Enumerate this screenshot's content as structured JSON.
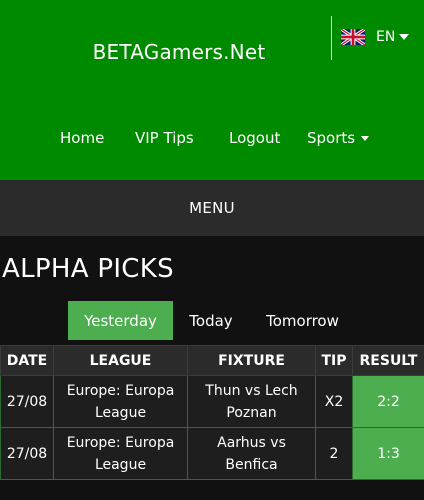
{
  "header": {
    "site_title": "BETAGamers.Net",
    "language": {
      "label": "EN",
      "flag_icon": "uk-flag-icon"
    }
  },
  "nav": {
    "items": [
      {
        "label": "Home"
      },
      {
        "label": "VIP Tips"
      },
      {
        "label": "Logout"
      },
      {
        "label": "Sports"
      }
    ]
  },
  "menu": {
    "label": "MENU"
  },
  "section": {
    "title": "ALPHA PICKS"
  },
  "tabs": [
    {
      "label": "Yesterday",
      "active": true
    },
    {
      "label": "Today",
      "active": false
    },
    {
      "label": "Tomorrow",
      "active": false
    }
  ],
  "table": {
    "headers": [
      "DATE",
      "LEAGUE",
      "FIXTURE",
      "TIP",
      "RESULT"
    ],
    "rows": [
      {
        "date": "27/08",
        "league": "Europe: Europa League",
        "fixture": "Thun vs Lech Poznan",
        "tip": "X2",
        "result": "2:2"
      },
      {
        "date": "27/08",
        "league": "Europe: Europa League",
        "fixture": "Aarhus vs Benfica",
        "tip": "2",
        "result": "1:3"
      }
    ]
  },
  "colors": {
    "header_green": "#008a00",
    "accent_green": "#4cae4f",
    "menu_bar": "#2b2b2b",
    "page_background": "#111111"
  }
}
